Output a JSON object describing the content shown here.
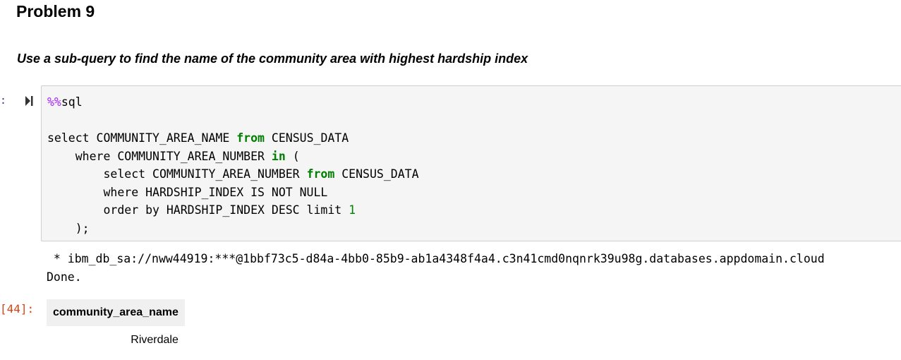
{
  "markdown": {
    "heading": "Problem 9",
    "question": "Use a sub-query to find the name of the community area with highest hardship index"
  },
  "code_cell": {
    "prompt": ":",
    "run_icon": "run-cell-icon",
    "magic": "%%",
    "magic_word": "sql",
    "lines": {
      "l1a": "select COMMUNITY_AREA_NAME ",
      "l1kw": "from",
      "l1b": " CENSUS_DATA",
      "l2a": "    where COMMUNITY_AREA_NUMBER ",
      "l2kw": "in",
      "l2b": " (",
      "l3a": "        select COMMUNITY_AREA_NUMBER ",
      "l3kw": "from",
      "l3b": " CENSUS_DATA",
      "l4": "        where HARDSHIP_INDEX IS NOT NULL",
      "l5a": "        order by HARDSHIP_INDEX DESC limit ",
      "l5num": "1",
      "l6": "    );"
    }
  },
  "output": {
    "connection_line": " * ibm_db_sa://nww44919:***@1bbf73c5-d84a-4bb0-85b9-ab1a4348f4a4.c3n41cmd0nqnrk39u98g.databases.appdomain.cloud",
    "done_line": "Done.",
    "prompt": "[44]:",
    "table": {
      "header": "community_area_name",
      "rows": [
        "Riverdale"
      ]
    }
  },
  "colors": {
    "keyword": "#008000",
    "magic": "#aa22ff",
    "out_prompt": "#d84315",
    "cell_bg": "#f5f5f5"
  }
}
